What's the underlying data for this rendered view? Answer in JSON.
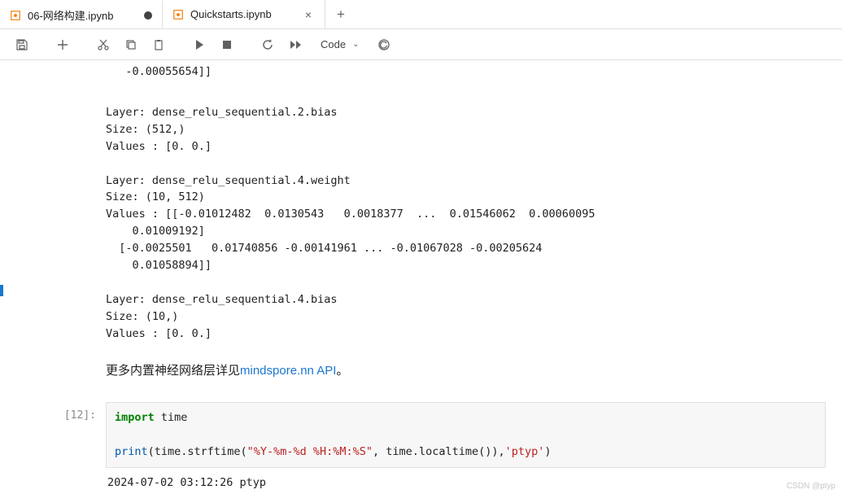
{
  "tabs": [
    {
      "name": "06-网络构建.ipynb",
      "modified": true
    },
    {
      "name": "Quickstarts.ipynb",
      "modified": false
    }
  ],
  "toolbar": {
    "cell_type": "Code"
  },
  "output": {
    "prev_tail": "   -0.00055654]]",
    "block1": "Layer: dense_relu_sequential.2.bias\nSize: (512,)\nValues : [0. 0.]",
    "block2": "Layer: dense_relu_sequential.4.weight\nSize: (10, 512)\nValues : [[-0.01012482  0.0130543   0.0018377  ...  0.01546062  0.00060095\n    0.01009192]\n  [-0.0025501   0.01740856 -0.00141961 ... -0.01067028 -0.00205624\n    0.01058894]]",
    "block3": "Layer: dense_relu_sequential.4.bias\nSize: (10,)\nValues : [0. 0.]"
  },
  "markdown": {
    "prefix": "更多内置神经网络层详见",
    "link_text": "mindspore.nn API",
    "suffix": "。"
  },
  "code_cell": {
    "prompt": "[12]:",
    "kw_import": "import",
    "mod": " time",
    "fn_print": "print",
    "paren_open": "(time.",
    "fn_strftime": "strftime",
    "str_fmt": "\"%Y-%m-%d %H:%M:%S\"",
    "mid": ", time.",
    "fn_localtime": "localtime",
    "tail": "()),",
    "str_ptyp": "'ptyp'",
    "close": ")",
    "output": "2024-07-02 03:12:26 ptyp"
  },
  "watermark": "CSDN @ptyp"
}
